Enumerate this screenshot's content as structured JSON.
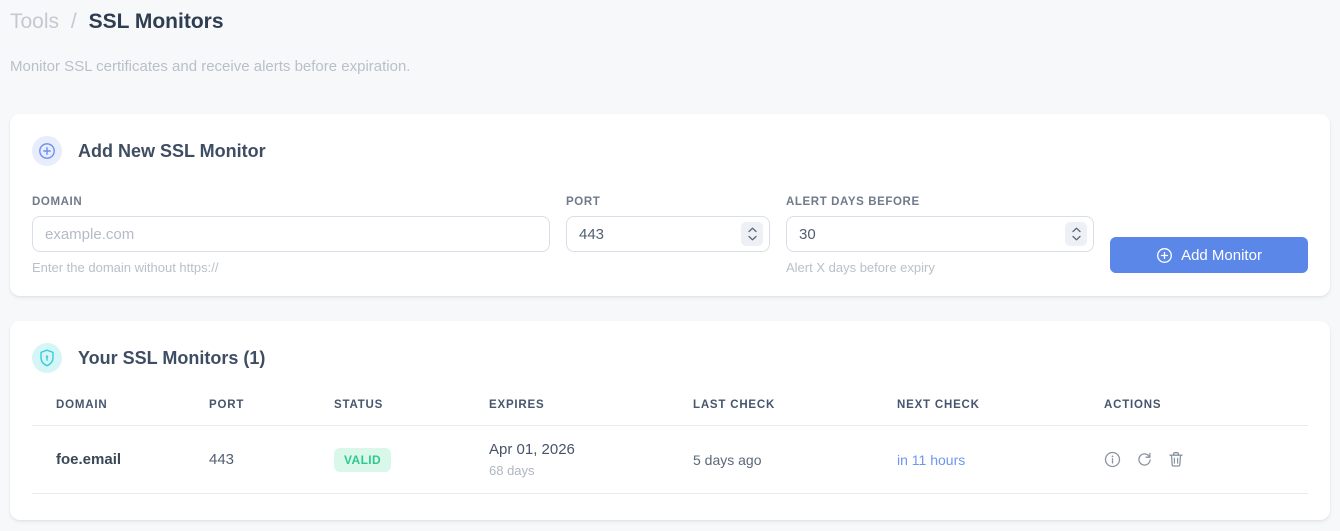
{
  "breadcrumb": {
    "section": "Tools",
    "separator": "/",
    "page": "SSL Monitors"
  },
  "subtitle": "Monitor SSL certificates and receive alerts before expiration.",
  "add_monitor_card": {
    "title": "Add New SSL Monitor",
    "fields": {
      "domain": {
        "label": "DOMAIN",
        "placeholder": "example.com",
        "value": "",
        "helper": "Enter the domain without https://"
      },
      "port": {
        "label": "PORT",
        "value": "443"
      },
      "alert_days": {
        "label": "ALERT DAYS BEFORE",
        "value": "30",
        "helper": "Alert X days before expiry"
      }
    },
    "submit_label": "Add Monitor"
  },
  "monitors_card": {
    "title": "Your SSL Monitors (1)",
    "table": {
      "headers": [
        "DOMAIN",
        "PORT",
        "STATUS",
        "EXPIRES",
        "LAST CHECK",
        "NEXT CHECK",
        "ACTIONS"
      ],
      "rows": [
        {
          "domain": "foe.email",
          "port": "443",
          "status": "VALID",
          "expires_date": "Apr 01, 2026",
          "expires_in": "68 days",
          "last_check": "5 days ago",
          "next_check": "in 11 hours",
          "action_icons": [
            "info",
            "refresh",
            "delete"
          ]
        }
      ]
    }
  },
  "colors": {
    "accent_blue": "#5b87e8",
    "badge_cyan": "#35cfdb",
    "valid_green": "#2ec98e",
    "valid_bg": "#d9f8ea",
    "link_blue": "#6d96f0"
  }
}
